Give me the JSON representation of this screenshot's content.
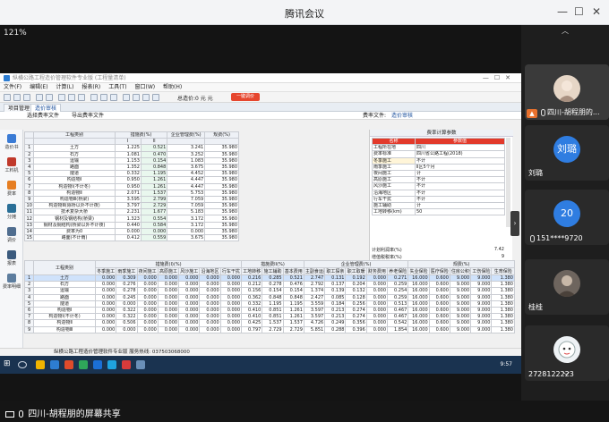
{
  "meeting": {
    "title": "腾讯会议",
    "zoom": "121%"
  },
  "shared_screen": {
    "app_title": "纵横公路工程造价管理软件专业版   (工程量清单)   ",
    "menus": [
      "文件(F)",
      "编辑(E)",
      "计算(L)",
      "报表(R)",
      "工具(T)",
      "窗口(W)",
      "帮助(H)"
    ],
    "toolbar_total": "总造价:0 元   元",
    "toolbar_button": "一键调价",
    "tabs": [
      "项目管理",
      "造价审核"
    ],
    "subbar": [
      "选择费率文件",
      "导出费率文件",
      "费率文件:",
      "造价审核"
    ],
    "left_nav": [
      "造价书",
      "工料机",
      "费率",
      "分摊",
      "调价",
      "报表",
      "费率明细"
    ],
    "rate_table": {
      "headers": [
        "",
        "工程类别",
        "措施费(%)",
        "",
        "企业管理费(%)",
        "规费(%)"
      ],
      "subheaders": [
        "",
        "",
        "I",
        "II",
        "",
        ""
      ],
      "rows": [
        [
          "1",
          "土方",
          "1.225",
          "0.521",
          "3.241",
          "35.980"
        ],
        [
          "2",
          "石方",
          "1.081",
          "0.470",
          "3.252",
          "35.980"
        ],
        [
          "3",
          "运输",
          "1.153",
          "0.154",
          "1.083",
          "35.980"
        ],
        [
          "4",
          "路面",
          "1.352",
          "0.848",
          "3.675",
          "35.980"
        ],
        [
          "5",
          "隧道",
          "0.332",
          "1.195",
          "4.452",
          "35.980"
        ],
        [
          "6",
          "构造物Ⅰ",
          "0.950",
          "1.261",
          "4.447",
          "35.980"
        ],
        [
          "7",
          "构造物Ⅰ(不计冬)",
          "0.950",
          "1.261",
          "4.447",
          "35.980"
        ],
        [
          "8",
          "构造物Ⅱ",
          "2.071",
          "1.537",
          "5.753",
          "35.980"
        ],
        [
          "9",
          "构造物Ⅲ(桥梁)",
          "3.595",
          "2.799",
          "7.059",
          "35.980"
        ],
        [
          "10",
          "构造物Ⅲ(除桥以外不计夜)",
          "3.797",
          "2.729",
          "7.059",
          "35.980"
        ],
        [
          "11",
          "技术复杂大桥",
          "2.231",
          "1.677",
          "5.183",
          "35.980"
        ],
        [
          "12",
          "钢材及钢结构(桥梁)",
          "1.323",
          "0.554",
          "3.172",
          "35.980"
        ],
        [
          "13",
          "钢材及钢结构(桥梁以外不计夜)",
          "0.440",
          "0.584",
          "3.172",
          "35.980"
        ],
        [
          "14",
          "费率为0",
          "0.000",
          "0.000",
          "0.000",
          "35.980"
        ],
        [
          "15",
          "路面(不计雨)",
          "0.412",
          "0.559",
          "3.675",
          "35.980"
        ]
      ]
    },
    "params": {
      "panel_title": "费率计算参数",
      "headers": [
        "名称",
        "参数值"
      ],
      "rows": [
        [
          "工程所在地",
          "四川"
        ],
        [
          "费率标准",
          "四川省公路工程(2018)"
        ],
        [
          "冬季施工",
          "不计"
        ],
        [
          "雨季施工",
          "Ⅱ区5个月"
        ],
        [
          "夜间施工",
          "计"
        ],
        [
          "高原施工",
          "不计"
        ],
        [
          "风沙施工",
          "不计"
        ],
        [
          "沿海地区",
          "不计"
        ],
        [
          "行车干扰",
          "不计"
        ],
        [
          "施工辅助",
          "计"
        ],
        [
          "工地转移(km)",
          "50"
        ]
      ],
      "footer_rows": [
        [
          "计划利润率(%)",
          "7.42"
        ],
        [
          "增值税税率(%)",
          "9"
        ]
      ]
    },
    "detail_table": {
      "group_headers": [
        "",
        "工程类别",
        "措施费(I)(%)",
        "措施费II(%)",
        "企业管理费(%)",
        "规费(%)"
      ],
      "headers": [
        "冬季施工",
        "雨季施工",
        "夜间施工",
        "高原施工",
        "风沙施工",
        "沿海地区",
        "行车干扰",
        "工地转移",
        "施工辅助",
        "基本费用",
        "主副食运费",
        "职工探亲",
        "职工取暖",
        "财务费用",
        "养老保险",
        "失业保险",
        "医疗保险",
        "住房公积金",
        "工伤保险",
        "生育保险"
      ],
      "rows": [
        [
          "1",
          "土方",
          "0.000",
          "0.309",
          "0.000",
          "0.000",
          "0.000",
          "0.000",
          "0.000",
          "0.216",
          "0.285",
          "0.521",
          "2.747",
          "0.131",
          "0.192",
          "0.000",
          "0.271",
          "16.000",
          "0.600",
          "9.000",
          "9.000",
          "1.380"
        ],
        [
          "2",
          "石方",
          "0.000",
          "0.276",
          "0.000",
          "0.000",
          "0.000",
          "0.000",
          "0.000",
          "0.212",
          "0.278",
          "0.476",
          "2.792",
          "0.137",
          "0.204",
          "0.000",
          "0.259",
          "16.000",
          "0.600",
          "9.000",
          "9.000",
          "1.380"
        ],
        [
          "3",
          "运输",
          "0.000",
          "0.278",
          "0.000",
          "0.000",
          "0.000",
          "0.000",
          "0.000",
          "0.156",
          "0.154",
          "0.154",
          "1.374",
          "0.139",
          "0.132",
          "0.000",
          "0.254",
          "16.000",
          "0.600",
          "9.000",
          "9.000",
          "1.380"
        ],
        [
          "4",
          "路面",
          "0.000",
          "0.245",
          "0.000",
          "0.000",
          "0.000",
          "0.000",
          "0.000",
          "0.362",
          "0.848",
          "0.848",
          "2.427",
          "0.085",
          "0.128",
          "0.000",
          "0.259",
          "16.000",
          "0.600",
          "9.000",
          "9.000",
          "1.380"
        ],
        [
          "5",
          "隧道",
          "0.000",
          "0.000",
          "0.000",
          "0.000",
          "0.000",
          "0.000",
          "0.000",
          "0.332",
          "1.195",
          "1.195",
          "3.559",
          "0.184",
          "0.256",
          "0.000",
          "0.513",
          "16.000",
          "0.600",
          "9.000",
          "9.000",
          "1.380"
        ],
        [
          "6",
          "构造物Ⅰ",
          "0.000",
          "0.322",
          "0.000",
          "0.000",
          "0.000",
          "0.000",
          "0.000",
          "0.410",
          "0.851",
          "1.261",
          "3.597",
          "0.213",
          "0.274",
          "0.000",
          "0.467",
          "16.000",
          "0.600",
          "9.000",
          "9.000",
          "1.380"
        ],
        [
          "7",
          "构造物Ⅰ(不计冬)",
          "0.000",
          "0.322",
          "0.000",
          "0.000",
          "0.000",
          "0.000",
          "0.000",
          "0.410",
          "0.851",
          "1.261",
          "3.597",
          "0.213",
          "0.274",
          "0.000",
          "0.467",
          "16.000",
          "0.600",
          "9.000",
          "9.000",
          "1.380"
        ],
        [
          "8",
          "构造物Ⅱ",
          "0.000",
          "0.506",
          "0.000",
          "0.000",
          "0.000",
          "0.000",
          "0.000",
          "0.425",
          "1.537",
          "1.537",
          "4.726",
          "0.249",
          "0.356",
          "0.000",
          "0.542",
          "16.000",
          "0.600",
          "9.000",
          "9.000",
          "1.380"
        ],
        [
          "9",
          "构造物Ⅲ",
          "0.000",
          "0.000",
          "0.000",
          "0.000",
          "0.000",
          "0.000",
          "0.000",
          "0.797",
          "2.729",
          "2.729",
          "5.851",
          "0.288",
          "0.396",
          "0.000",
          "1.854",
          "16.000",
          "0.600",
          "9.000",
          "9.000",
          "1.380"
        ]
      ]
    },
    "status_bar": "纵横公路工程造价管理软件专业版          服务热线:  037503068000",
    "taskbar_time": "9:57"
  },
  "participants": [
    {
      "name": "四川-胡程朋的...",
      "initials": "",
      "avatar_color": "#c9b8a8",
      "is_sharing": true
    },
    {
      "name": "刘璐",
      "initials": "刘璐",
      "avatar_color": "#2f7de1",
      "is_sharing": false
    },
    {
      "name": "151****9720",
      "initials": "20",
      "avatar_color": "#2f7de1",
      "is_sharing": false
    },
    {
      "name": "桂桂",
      "initials": "",
      "avatar_color": "#8e8278",
      "is_sharing": false
    },
    {
      "name": "2728122223",
      "initials": "",
      "avatar_color": "#d8dde3",
      "is_sharing": false
    }
  ],
  "share_label": "四川-胡程朋的屏幕共享",
  "colors": {
    "accent": "#e23a2b",
    "participant_orange": "#e8712e",
    "avatar_blue": "#2f7de1"
  }
}
